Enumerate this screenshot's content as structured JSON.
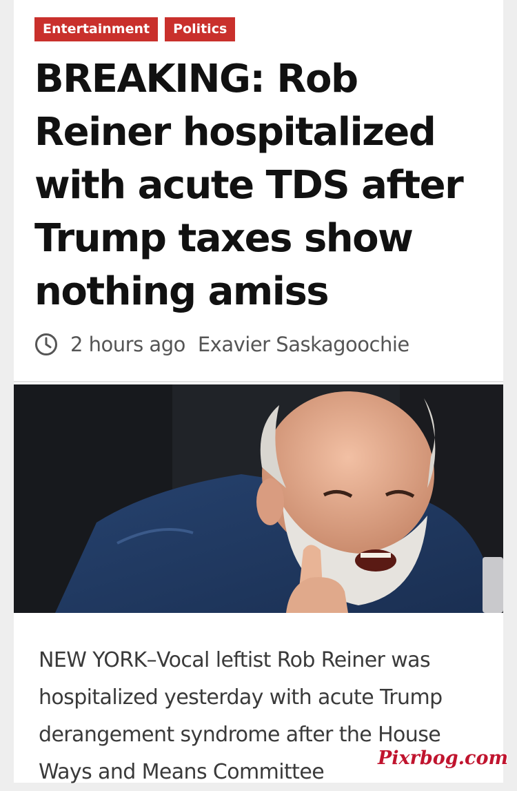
{
  "categories": [
    "Entertainment",
    "Politics"
  ],
  "headline": "BREAKING: Rob Reiner hospitalized with acute TDS after Trump taxes show nothing amiss",
  "meta": {
    "time_icon": "clock-icon",
    "time": "2 hours ago",
    "author": "Exavier Saskagoochie"
  },
  "photo": {
    "alt": "Photo of Rob Reiner"
  },
  "article": {
    "lead": "NEW YORK–Vocal leftist Rob Reiner was hospitalized yesterday with acute Trump derangement syndrome after the House Ways and Means Committee"
  },
  "watermark": "Pixrbog.com",
  "colors": {
    "tag_background": "#c9302c",
    "headline": "#111111",
    "meta_text": "#555555",
    "watermark": "#c0142e"
  }
}
